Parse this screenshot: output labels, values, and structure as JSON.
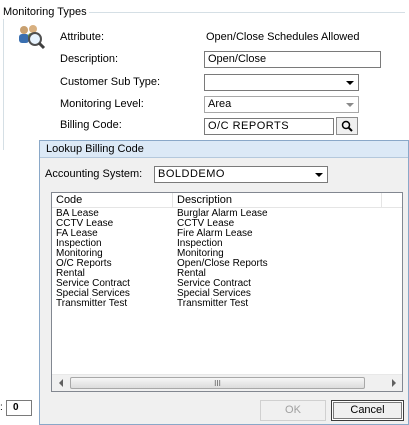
{
  "monitoring_types": {
    "legend": "Monitoring Types",
    "fields": {
      "attribute": {
        "label": "Attribute:",
        "value": "Open/Close Schedules Allowed"
      },
      "description": {
        "label": "Description:",
        "value": "Open/Close"
      },
      "customer_sub_type": {
        "label": "Customer Sub Type:",
        "value": ""
      },
      "monitoring_level": {
        "label": "Monitoring Level:",
        "value": "Area"
      },
      "billing_code": {
        "label": "Billing Code:",
        "value": "O/C REPORTS"
      }
    }
  },
  "lookup_dialog": {
    "title": "Lookup Billing Code",
    "accounting_system_label": "Accounting System:",
    "accounting_system_value": "BOLDDEMO",
    "columns": [
      "Code",
      "Description"
    ],
    "rows": [
      [
        "BA Lease",
        "Burglar Alarm Lease"
      ],
      [
        "CCTV Lease",
        "CCTV Lease"
      ],
      [
        "FA Lease",
        "Fire Alarm Lease"
      ],
      [
        "Inspection",
        "Inspection"
      ],
      [
        "Monitoring",
        "Monitoring"
      ],
      [
        "O/C Reports",
        "Open/Close Reports"
      ],
      [
        "Rental",
        "Rental"
      ],
      [
        "Service Contract",
        "Service Contract"
      ],
      [
        "Special Services",
        "Special Services"
      ],
      [
        "Transmitter Test",
        "Transmitter Test"
      ]
    ],
    "scroll_thumb_grip": "III",
    "ok_label": "OK",
    "cancel_label": "Cancel"
  },
  "side_field": {
    "prefix": ":",
    "value": "0"
  }
}
